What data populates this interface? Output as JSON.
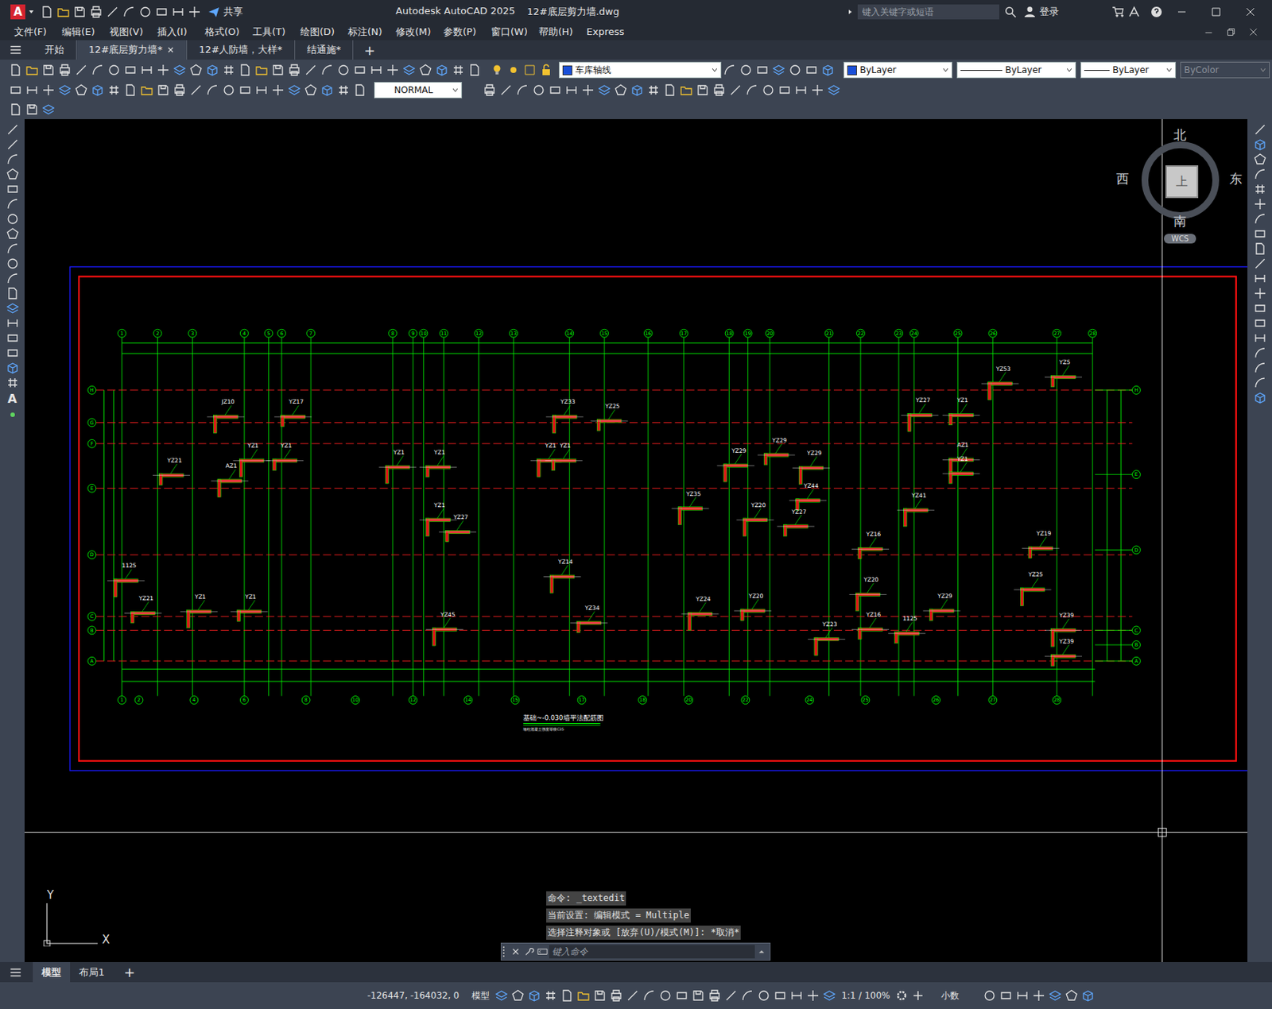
{
  "window": {
    "logo": "A",
    "share": "共享",
    "app": "Autodesk AutoCAD 2025",
    "file": "12#底层剪力墙.dwg",
    "search_placeholder": "键入关键字或短语",
    "login": "登录"
  },
  "menu": [
    "文件(F)",
    "编辑(E)",
    "视图(V)",
    "插入(I)",
    "格式(O)",
    "工具(T)",
    "绘图(D)",
    "标注(N)",
    "修改(M)",
    "参数(P)",
    "窗口(W)",
    "帮助(H)",
    "Express"
  ],
  "doc_tabs": [
    {
      "label": "开始",
      "selected": false,
      "closable": false
    },
    {
      "label": "12#底层剪力墙*",
      "selected": true,
      "closable": true
    },
    {
      "label": "12#人防墙，大样*",
      "selected": false,
      "closable": false
    },
    {
      "label": "结通施*",
      "selected": false,
      "closable": false
    }
  ],
  "new_tab": "+",
  "properties": {
    "layer": "车库轴线",
    "color": "ByLayer",
    "linetype": "ByLayer",
    "lineweight": "ByLayer",
    "plotstyle": {
      "label": "ByColor",
      "disabled": true
    }
  },
  "text_style": "NORMAL",
  "viewcube": {
    "face": "上",
    "north": "北",
    "south": "南",
    "east": "东",
    "west": "西",
    "ucs": "WCS"
  },
  "ucs_icon": {
    "x": "X",
    "y": "Y"
  },
  "left_tool_text": "A",
  "drawing": {
    "title": "基础~-0.030墙平法配筋图",
    "subtitle": "墙柱混凝土强度等级C35",
    "top_axes": [
      "1",
      "2",
      "3",
      "4",
      "5",
      "6",
      "7",
      "8",
      "9",
      "10",
      "11",
      "12",
      "13",
      "14",
      "15",
      "16",
      "17",
      "18",
      "19",
      "20",
      "21",
      "22",
      "23",
      "24",
      "25",
      "26",
      "27",
      "28"
    ],
    "bottom_axes": [
      "1",
      "2",
      "4",
      "6",
      "8",
      "10",
      "12",
      "14",
      "15",
      "17",
      "18",
      "20",
      "22",
      "24",
      "25",
      "26",
      "27",
      "28"
    ],
    "left_axes": [
      "H",
      "G",
      "F",
      "E",
      "D",
      "C",
      "B",
      "A"
    ],
    "right_axes": [
      "H",
      "E",
      "D",
      "C",
      "B",
      "A"
    ],
    "wall_labels": [
      "JZ10",
      "YZ17",
      "YZ1",
      "YZ1",
      "YZ1",
      "YZ1",
      "YZ33",
      "YZ25",
      "YZ1",
      "YZ1",
      "YZ29",
      "YZ29",
      "YZ29",
      "YZ44",
      "YZ27",
      "YZ1",
      "AZ1",
      "YZ1",
      "YZ53",
      "YZ5",
      "YZ20",
      "YZ27",
      "YZ1",
      "YZ27",
      "YZ35",
      "YZ16",
      "YZ41",
      "YZ19",
      "YZ25",
      "YZ21",
      "YZ1",
      "YZ1",
      "YZ45",
      "YZ34",
      "YZ24",
      "YZ20",
      "YZ20",
      "YZ16",
      "YZ23",
      "YZ29",
      "YZ39",
      "YZ39",
      "1125",
      "1125",
      "YZ14",
      "YZ21",
      "AZ1"
    ]
  },
  "command": {
    "history": [
      "命令: _textedit",
      "当前设置: 编辑模式 = Multiple",
      "选择注释对象或 [放弃(U)/模式(M)]: *取消*"
    ],
    "placeholder": "键入命令"
  },
  "layout_tabs": [
    {
      "label": "模型",
      "selected": true
    },
    {
      "label": "布局1",
      "selected": false
    }
  ],
  "layout_add": "+",
  "status_bar": {
    "coords": "-126447, -164032, 0",
    "space": "模型",
    "scale": "1:1 / 100%",
    "units": "小数"
  }
}
